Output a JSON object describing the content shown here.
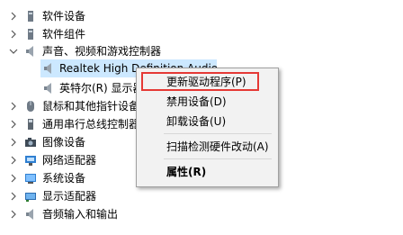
{
  "tree": {
    "items": [
      {
        "label": "软件设备",
        "icon": "software-device-icon",
        "expanded": false
      },
      {
        "label": "软件组件",
        "icon": "software-component-icon",
        "expanded": false
      },
      {
        "label": "声音、视频和游戏控制器",
        "icon": "speaker-icon",
        "expanded": true
      },
      {
        "label": "Realtek High Definition Audio",
        "icon": "speaker-icon",
        "child": true,
        "selected": true
      },
      {
        "label": "英特尔(R) 显示器音频",
        "icon": "speaker-icon",
        "child": true
      },
      {
        "label": "鼠标和其他指针设备",
        "icon": "mouse-icon",
        "expanded": false
      },
      {
        "label": "通用串行总线控制器",
        "icon": "usb-icon",
        "expanded": false
      },
      {
        "label": "图像设备",
        "icon": "camera-icon",
        "expanded": false
      },
      {
        "label": "网络适配器",
        "icon": "network-adapter-icon",
        "expanded": false
      },
      {
        "label": "系统设备",
        "icon": "system-device-icon",
        "expanded": false
      },
      {
        "label": "显示适配器",
        "icon": "display-adapter-icon",
        "expanded": false
      },
      {
        "label": "音频输入和输出",
        "icon": "audio-io-icon",
        "expanded": false
      }
    ]
  },
  "context_menu": {
    "items": [
      {
        "label": "更新驱动程序(P)",
        "highlighted": true
      },
      {
        "label": "禁用设备(D)"
      },
      {
        "label": "卸载设备(U)"
      },
      {
        "label": "扫描检测硬件改动(A)"
      },
      {
        "label": "属性(R)",
        "bold": true
      }
    ]
  },
  "colors": {
    "selection": "#cce8ff",
    "highlight_border": "#e53935",
    "menu_bg": "#f2f2f2"
  }
}
